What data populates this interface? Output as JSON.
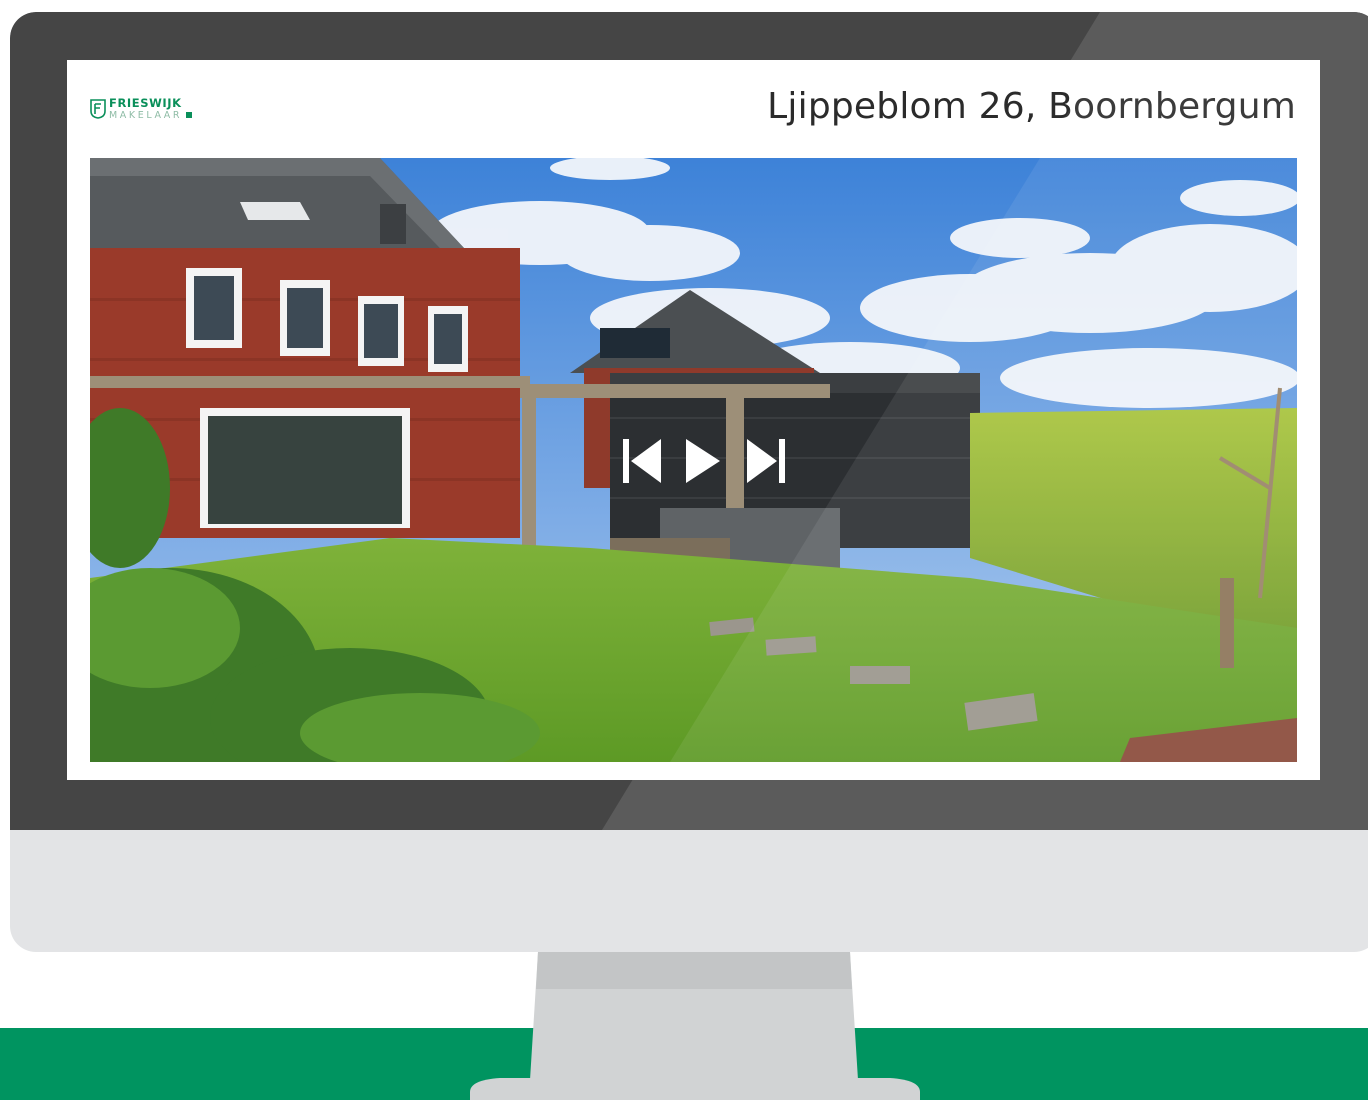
{
  "listing": {
    "title": "Ljippeblom 26, Boornbergum"
  },
  "brand": {
    "name": "FRIESWIJK",
    "sub": "MAKELAAR",
    "color": "#0a8f5a"
  },
  "viewer": {
    "controls": [
      {
        "name": "previous-button",
        "icon": "skip-previous-icon"
      },
      {
        "name": "play-button",
        "icon": "play-icon"
      },
      {
        "name": "next-button",
        "icon": "skip-next-icon"
      }
    ]
  },
  "colors": {
    "floor": "#009460",
    "bezel": "#454545",
    "monitor_body": "#e3e4e6"
  }
}
